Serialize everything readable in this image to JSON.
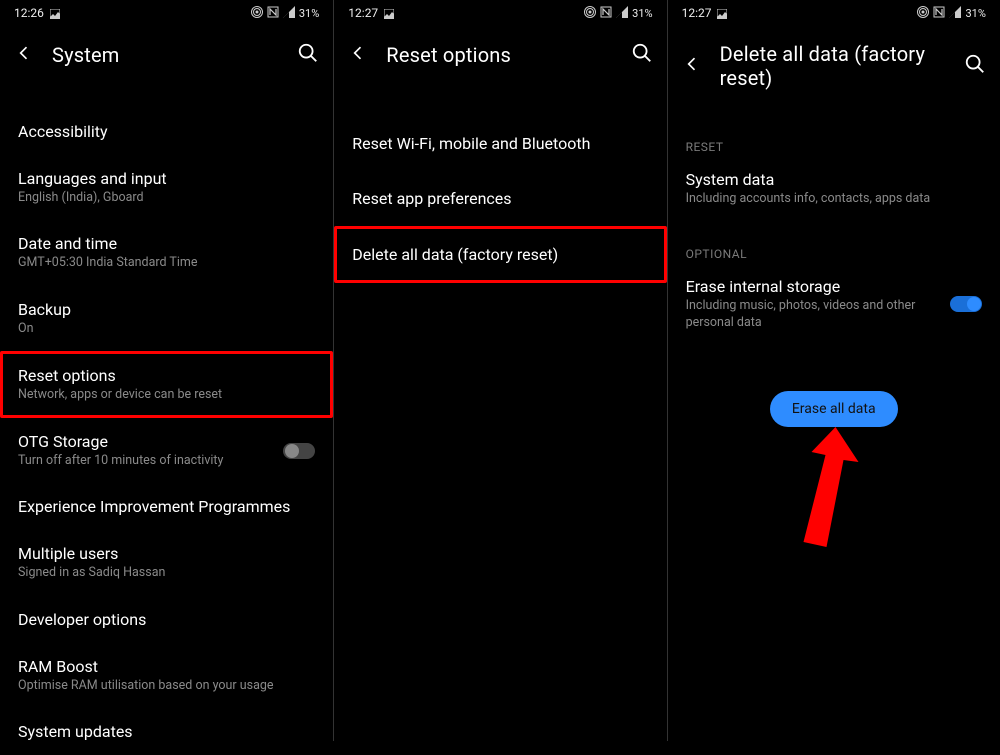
{
  "status": {
    "time1": "12:26",
    "time2": "12:27",
    "time3": "12:27",
    "battery": "31%"
  },
  "screen1": {
    "title": "System",
    "items": [
      {
        "title": "Accessibility",
        "sub": ""
      },
      {
        "title": "Languages and input",
        "sub": "English (India), Gboard"
      },
      {
        "title": "Date and time",
        "sub": "GMT+05:30 India Standard Time"
      },
      {
        "title": "Backup",
        "sub": "On"
      },
      {
        "title": "Reset options",
        "sub": "Network, apps or device can be reset"
      },
      {
        "title": "OTG Storage",
        "sub": "Turn off after 10 minutes of inactivity"
      },
      {
        "title": "Experience Improvement Programmes",
        "sub": ""
      },
      {
        "title": "Multiple users",
        "sub": "Signed in as Sadiq Hassan"
      },
      {
        "title": "Developer options",
        "sub": ""
      },
      {
        "title": "RAM Boost",
        "sub": "Optimise RAM utilisation based on your usage"
      },
      {
        "title": "System updates",
        "sub": ""
      }
    ]
  },
  "screen2": {
    "title": "Reset options",
    "items": [
      {
        "title": "Reset Wi-Fi, mobile and Bluetooth"
      },
      {
        "title": "Reset app preferences"
      },
      {
        "title": "Delete all data (factory reset)"
      }
    ]
  },
  "screen3": {
    "title": "Delete all data (factory reset)",
    "resetLabel": "RESET",
    "systemData": {
      "title": "System data",
      "sub": "Including accounts info, contacts, apps data"
    },
    "optionalLabel": "OPTIONAL",
    "eraseStorage": {
      "title": "Erase internal storage",
      "sub": "Including music, photos, videos and other personal data"
    },
    "button": "Erase all data"
  }
}
